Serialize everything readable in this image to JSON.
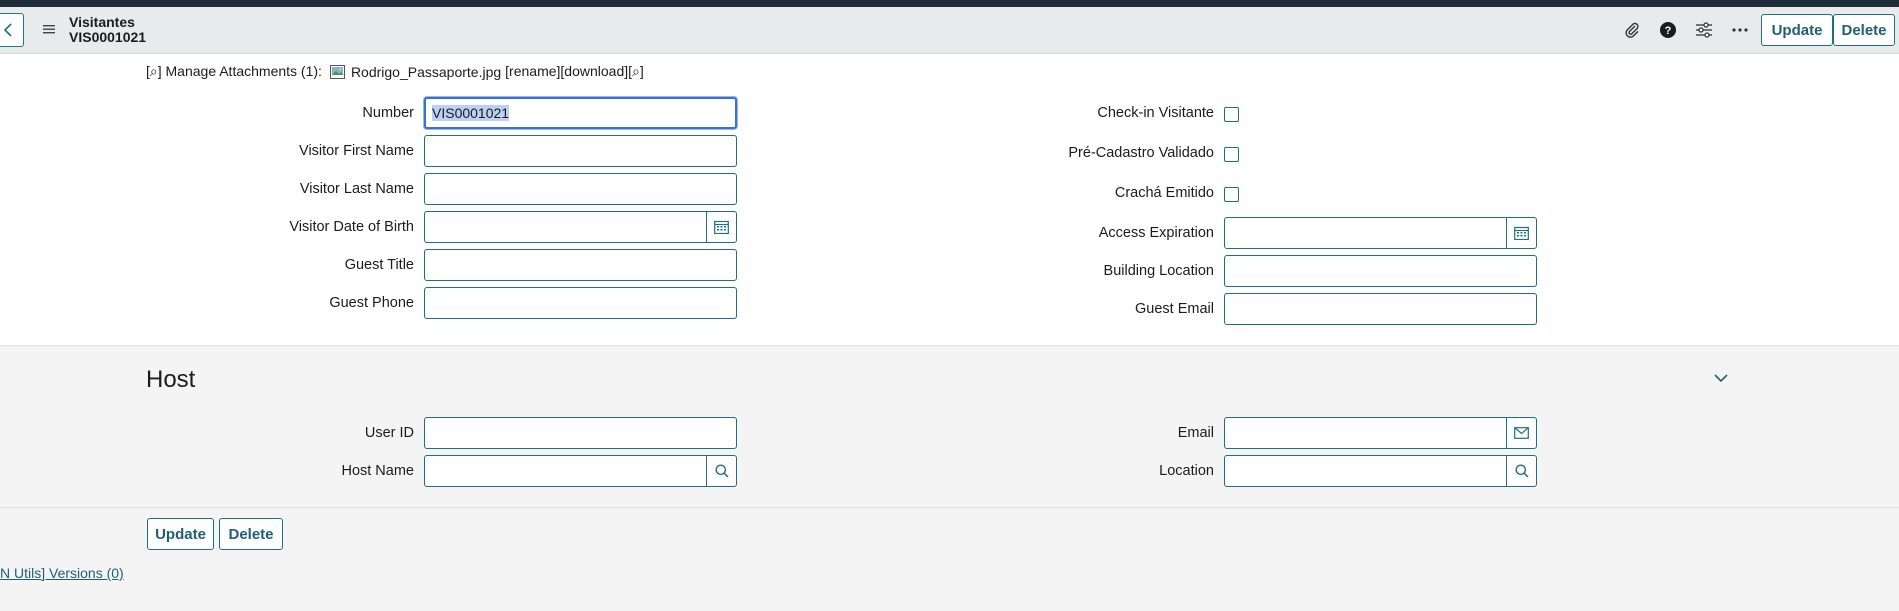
{
  "header": {
    "title": "Visitantes",
    "record_number": "VIS0001021",
    "update_label": "Update",
    "delete_label": "Delete"
  },
  "attachments": {
    "manage_text": "[⌕] Manage Attachments (1):",
    "filename": "Rodrigo_Passaporte.jpg",
    "actions": "[rename][download][⌕]"
  },
  "form": {
    "number_label": "Number",
    "number_value": "VIS0001021",
    "first_name_label": "Visitor First Name",
    "last_name_label": "Visitor Last Name",
    "dob_label": "Visitor Date of Birth",
    "guest_title_label": "Guest Title",
    "guest_phone_label": "Guest Phone",
    "checkin_label": "Check-in Visitante",
    "precadastro_label": "Pré-Cadastro Validado",
    "cracha_label": "Crachá Emitido",
    "access_exp_label": "Access Expiration",
    "building_label": "Building Location",
    "guest_email_label": "Guest Email"
  },
  "host": {
    "section_title": "Host",
    "user_id_label": "User ID",
    "host_name_label": "Host Name",
    "email_label": "Email",
    "location_label": "Location"
  },
  "footer": {
    "update_label": "Update",
    "delete_label": "Delete",
    "versions_link": "N Utils] Versions (0)"
  },
  "colors": {
    "accent": "#1f6f80",
    "header_bg": "#e9eaeb",
    "topbar": "#1f2e3a",
    "focus": "#3a6fd8"
  }
}
